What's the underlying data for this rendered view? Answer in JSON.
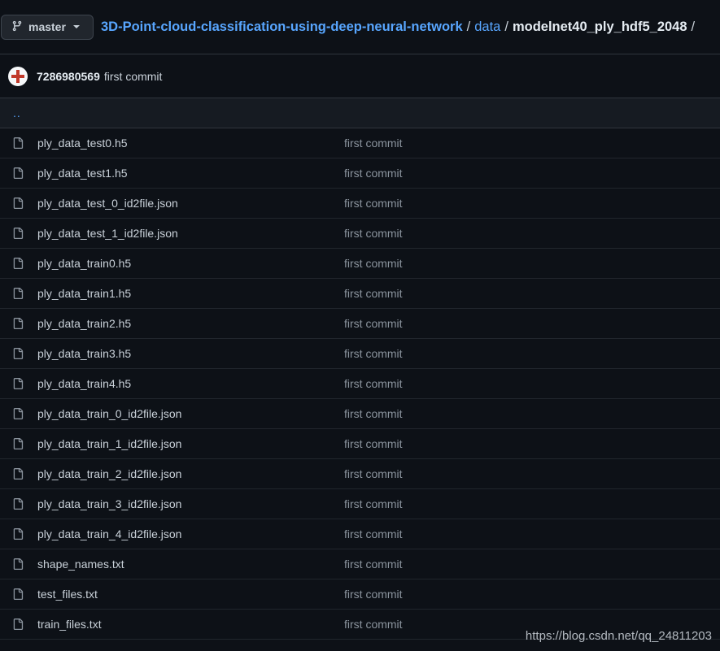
{
  "branch": {
    "label": "master",
    "icon": "git-branch-icon"
  },
  "breadcrumb": {
    "repo": "3D-Point-cloud-classification-using-deep-neural-network",
    "folder": "data",
    "current": "modelnet40_ply_hdf5_2048",
    "separator": "/"
  },
  "latest_commit": {
    "author": "7286980569",
    "message": "first commit"
  },
  "parent_dir": "..",
  "files": [
    {
      "name": "ply_data_test0.h5",
      "commit": "first commit"
    },
    {
      "name": "ply_data_test1.h5",
      "commit": "first commit"
    },
    {
      "name": "ply_data_test_0_id2file.json",
      "commit": "first commit"
    },
    {
      "name": "ply_data_test_1_id2file.json",
      "commit": "first commit"
    },
    {
      "name": "ply_data_train0.h5",
      "commit": "first commit"
    },
    {
      "name": "ply_data_train1.h5",
      "commit": "first commit"
    },
    {
      "name": "ply_data_train2.h5",
      "commit": "first commit"
    },
    {
      "name": "ply_data_train3.h5",
      "commit": "first commit"
    },
    {
      "name": "ply_data_train4.h5",
      "commit": "first commit"
    },
    {
      "name": "ply_data_train_0_id2file.json",
      "commit": "first commit"
    },
    {
      "name": "ply_data_train_1_id2file.json",
      "commit": "first commit"
    },
    {
      "name": "ply_data_train_2_id2file.json",
      "commit": "first commit"
    },
    {
      "name": "ply_data_train_3_id2file.json",
      "commit": "first commit"
    },
    {
      "name": "ply_data_train_4_id2file.json",
      "commit": "first commit"
    },
    {
      "name": "shape_names.txt",
      "commit": "first commit"
    },
    {
      "name": "test_files.txt",
      "commit": "first commit"
    },
    {
      "name": "train_files.txt",
      "commit": "first commit"
    }
  ],
  "watermark": "https://blog.csdn.net/qq_24811203",
  "colors": {
    "background": "#0d1117",
    "link": "#58a6ff",
    "muted": "#8b949e",
    "border": "#30363d"
  }
}
